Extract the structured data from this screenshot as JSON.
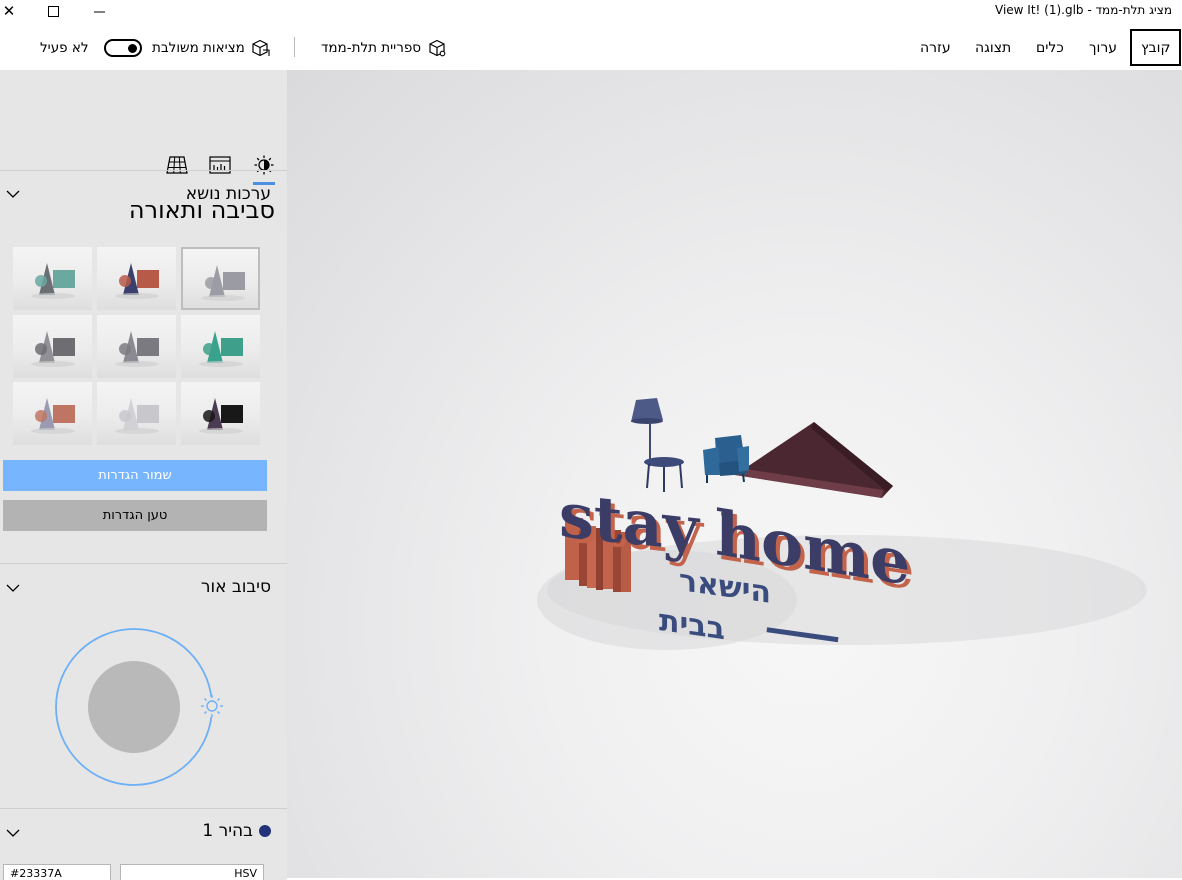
{
  "window": {
    "title": "מציג תלת-ממד - View It! (1).glb",
    "controls": {
      "close": "✕",
      "maximize": "☐",
      "minimize": "—"
    }
  },
  "menu": {
    "items": [
      {
        "label": "קובץ",
        "active": true
      },
      {
        "label": "ערוך"
      },
      {
        "label": "כלים"
      },
      {
        "label": "תצוגה"
      },
      {
        "label": "עזרה"
      }
    ]
  },
  "toolbar": {
    "library_label": "ספריית תלת-ממד",
    "mixed_reality_label": "מציאות משולבת",
    "toggle_state_label": "לא פעיל",
    "toggle_on": false
  },
  "sidebar": {
    "tabs": [
      {
        "name": "lighting",
        "icon": "sun-icon",
        "selected": true
      },
      {
        "name": "stats",
        "icon": "chart-icon",
        "selected": false
      },
      {
        "name": "grid",
        "icon": "grid-icon",
        "selected": false
      }
    ],
    "section_title": "סביבה ותאורה",
    "themes": {
      "title": "ערכות נושא",
      "swatches": [
        {
          "accent": "#9b9ba3",
          "shape": "#9c9ca4",
          "selected": true
        },
        {
          "accent": "#b85a48",
          "shape": "#3b3f6b",
          "selected": false
        },
        {
          "accent": "#6aa8a0",
          "shape": "#6b6f74",
          "selected": false
        },
        {
          "accent": "#3ea08a",
          "shape": "#38a28c",
          "selected": false
        },
        {
          "accent": "#7a7a80",
          "shape": "#8a8a90",
          "selected": false
        },
        {
          "accent": "#6d6d72",
          "shape": "#909096",
          "selected": false
        },
        {
          "accent": "#181818",
          "shape": "#4a3a52",
          "selected": false
        },
        {
          "accent": "#c8c8cc",
          "shape": "#d2d2d6",
          "selected": false
        },
        {
          "accent": "#c07564",
          "shape": "#9a9ab0",
          "selected": false
        }
      ],
      "save_label": "שמור הגדרות",
      "load_label": "טען הגדרות"
    },
    "light_rotation": {
      "title": "סיבוב אור"
    },
    "light1": {
      "title": "בהיר 1",
      "color": "#23337A",
      "hex_value": "#23337A",
      "mode_value": "HSV"
    }
  },
  "colors": {
    "accent": "#4a90e2",
    "save_button": "#77b5ff",
    "sidebar_bg": "#e6e6e6"
  }
}
